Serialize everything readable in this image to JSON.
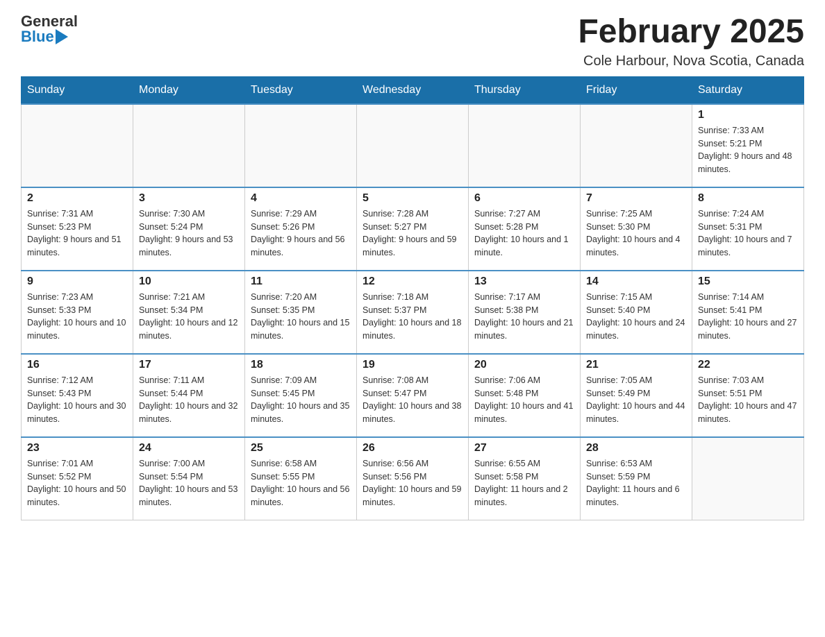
{
  "header": {
    "logo": {
      "text_general": "General",
      "text_blue": "Blue"
    },
    "title": "February 2025",
    "location": "Cole Harbour, Nova Scotia, Canada"
  },
  "days_of_week": [
    "Sunday",
    "Monday",
    "Tuesday",
    "Wednesday",
    "Thursday",
    "Friday",
    "Saturday"
  ],
  "weeks": [
    [
      {
        "day": "",
        "info": ""
      },
      {
        "day": "",
        "info": ""
      },
      {
        "day": "",
        "info": ""
      },
      {
        "day": "",
        "info": ""
      },
      {
        "day": "",
        "info": ""
      },
      {
        "day": "",
        "info": ""
      },
      {
        "day": "1",
        "info": "Sunrise: 7:33 AM\nSunset: 5:21 PM\nDaylight: 9 hours and 48 minutes."
      }
    ],
    [
      {
        "day": "2",
        "info": "Sunrise: 7:31 AM\nSunset: 5:23 PM\nDaylight: 9 hours and 51 minutes."
      },
      {
        "day": "3",
        "info": "Sunrise: 7:30 AM\nSunset: 5:24 PM\nDaylight: 9 hours and 53 minutes."
      },
      {
        "day": "4",
        "info": "Sunrise: 7:29 AM\nSunset: 5:26 PM\nDaylight: 9 hours and 56 minutes."
      },
      {
        "day": "5",
        "info": "Sunrise: 7:28 AM\nSunset: 5:27 PM\nDaylight: 9 hours and 59 minutes."
      },
      {
        "day": "6",
        "info": "Sunrise: 7:27 AM\nSunset: 5:28 PM\nDaylight: 10 hours and 1 minute."
      },
      {
        "day": "7",
        "info": "Sunrise: 7:25 AM\nSunset: 5:30 PM\nDaylight: 10 hours and 4 minutes."
      },
      {
        "day": "8",
        "info": "Sunrise: 7:24 AM\nSunset: 5:31 PM\nDaylight: 10 hours and 7 minutes."
      }
    ],
    [
      {
        "day": "9",
        "info": "Sunrise: 7:23 AM\nSunset: 5:33 PM\nDaylight: 10 hours and 10 minutes."
      },
      {
        "day": "10",
        "info": "Sunrise: 7:21 AM\nSunset: 5:34 PM\nDaylight: 10 hours and 12 minutes."
      },
      {
        "day": "11",
        "info": "Sunrise: 7:20 AM\nSunset: 5:35 PM\nDaylight: 10 hours and 15 minutes."
      },
      {
        "day": "12",
        "info": "Sunrise: 7:18 AM\nSunset: 5:37 PM\nDaylight: 10 hours and 18 minutes."
      },
      {
        "day": "13",
        "info": "Sunrise: 7:17 AM\nSunset: 5:38 PM\nDaylight: 10 hours and 21 minutes."
      },
      {
        "day": "14",
        "info": "Sunrise: 7:15 AM\nSunset: 5:40 PM\nDaylight: 10 hours and 24 minutes."
      },
      {
        "day": "15",
        "info": "Sunrise: 7:14 AM\nSunset: 5:41 PM\nDaylight: 10 hours and 27 minutes."
      }
    ],
    [
      {
        "day": "16",
        "info": "Sunrise: 7:12 AM\nSunset: 5:43 PM\nDaylight: 10 hours and 30 minutes."
      },
      {
        "day": "17",
        "info": "Sunrise: 7:11 AM\nSunset: 5:44 PM\nDaylight: 10 hours and 32 minutes."
      },
      {
        "day": "18",
        "info": "Sunrise: 7:09 AM\nSunset: 5:45 PM\nDaylight: 10 hours and 35 minutes."
      },
      {
        "day": "19",
        "info": "Sunrise: 7:08 AM\nSunset: 5:47 PM\nDaylight: 10 hours and 38 minutes."
      },
      {
        "day": "20",
        "info": "Sunrise: 7:06 AM\nSunset: 5:48 PM\nDaylight: 10 hours and 41 minutes."
      },
      {
        "day": "21",
        "info": "Sunrise: 7:05 AM\nSunset: 5:49 PM\nDaylight: 10 hours and 44 minutes."
      },
      {
        "day": "22",
        "info": "Sunrise: 7:03 AM\nSunset: 5:51 PM\nDaylight: 10 hours and 47 minutes."
      }
    ],
    [
      {
        "day": "23",
        "info": "Sunrise: 7:01 AM\nSunset: 5:52 PM\nDaylight: 10 hours and 50 minutes."
      },
      {
        "day": "24",
        "info": "Sunrise: 7:00 AM\nSunset: 5:54 PM\nDaylight: 10 hours and 53 minutes."
      },
      {
        "day": "25",
        "info": "Sunrise: 6:58 AM\nSunset: 5:55 PM\nDaylight: 10 hours and 56 minutes."
      },
      {
        "day": "26",
        "info": "Sunrise: 6:56 AM\nSunset: 5:56 PM\nDaylight: 10 hours and 59 minutes."
      },
      {
        "day": "27",
        "info": "Sunrise: 6:55 AM\nSunset: 5:58 PM\nDaylight: 11 hours and 2 minutes."
      },
      {
        "day": "28",
        "info": "Sunrise: 6:53 AM\nSunset: 5:59 PM\nDaylight: 11 hours and 6 minutes."
      },
      {
        "day": "",
        "info": ""
      }
    ]
  ]
}
